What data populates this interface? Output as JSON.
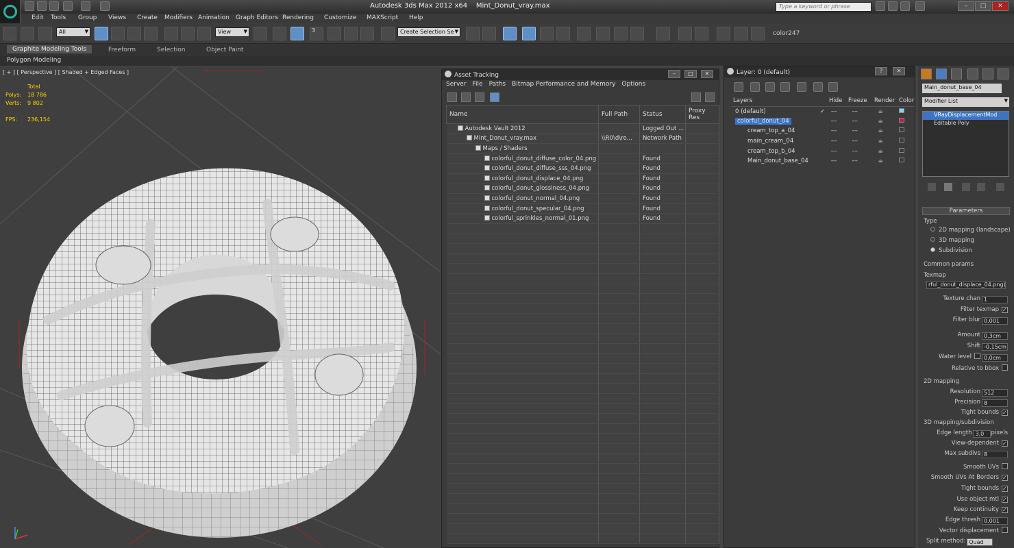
{
  "title": {
    "app": "Autodesk 3ds Max  2012 x64",
    "file": "Mint_Donut_vray.max",
    "search_placeholder": "Type a keyword or phrase"
  },
  "menu": [
    "Edit",
    "Tools",
    "Group",
    "Views",
    "Create",
    "Modifiers",
    "Animation",
    "Graph Editors",
    "Rendering",
    "Customize",
    "MAXScript",
    "Help"
  ],
  "toolbar": {
    "filter": "All",
    "refcoord": "View",
    "selset": "Create Selection Se",
    "color_label": "color247",
    "snap_label": "3"
  },
  "ribbon": {
    "tabs": [
      "Graphite Modeling Tools",
      "Freeform",
      "Selection",
      "Object Paint"
    ],
    "sub": "Polygon Modeling"
  },
  "viewport": {
    "label": "[ + ] [ Perspective ] [ Shaded + Edged Faces ]",
    "stats": {
      "total": "Total",
      "polys_label": "Polys:",
      "polys": "18 786",
      "verts_label": "Verts:",
      "verts": "9 802",
      "fps_label": "FPS:",
      "fps": "236,154"
    }
  },
  "asset": {
    "title": "Asset Tracking",
    "menu": [
      "Server",
      "File",
      "Paths",
      "Bitmap Performance and Memory",
      "Options"
    ],
    "columns": [
      "Name",
      "Full Path",
      "Status",
      "Proxy Res"
    ],
    "rows": [
      {
        "name": "Autodesk Vault 2012",
        "path": "",
        "status": "Logged Out ...",
        "indent": 0
      },
      {
        "name": "Mint_Donut_vray.max",
        "path": "\\\\R0\\d\\re...",
        "status": "Network Path",
        "indent": 1
      },
      {
        "name": "Maps / Shaders",
        "path": "",
        "status": "",
        "indent": 2
      },
      {
        "name": "colorful_donut_diffuse_color_04.png",
        "path": "",
        "status": "Found",
        "indent": 3
      },
      {
        "name": "colorful_donut_diffuse_sss_04.png",
        "path": "",
        "status": "Found",
        "indent": 3
      },
      {
        "name": "colorful_donut_displace_04.png",
        "path": "",
        "status": "Found",
        "indent": 3
      },
      {
        "name": "colorful_donut_glossiness_04.png",
        "path": "",
        "status": "Found",
        "indent": 3
      },
      {
        "name": "colorful_donut_normal_04.png",
        "path": "",
        "status": "Found",
        "indent": 3
      },
      {
        "name": "colorful_donut_specular_04.png",
        "path": "",
        "status": "Found",
        "indent": 3
      },
      {
        "name": "colorful_sprinkles_normal_01.png",
        "path": "",
        "status": "Found",
        "indent": 3
      }
    ]
  },
  "layers": {
    "title": "Layer: 0 (default)",
    "columns": [
      "Layers",
      "Hide",
      "Freeze",
      "Render",
      "Color"
    ],
    "rows": [
      {
        "name": "0 (default)",
        "indent": 0,
        "color": "#7fd4ff",
        "sel": false,
        "check": "✓"
      },
      {
        "name": "colorful_donut_04",
        "indent": 0,
        "color": "#c8184a",
        "sel": true,
        "check": ""
      },
      {
        "name": "cream_top_a_04",
        "indent": 1,
        "color": "",
        "sel": false,
        "check": ""
      },
      {
        "name": "main_cream_04",
        "indent": 1,
        "color": "",
        "sel": false,
        "check": ""
      },
      {
        "name": "cream_top_b_04",
        "indent": 1,
        "color": "",
        "sel": false,
        "check": ""
      },
      {
        "name": "Main_donut_base_04",
        "indent": 1,
        "color": "",
        "sel": false,
        "check": ""
      }
    ]
  },
  "cmd": {
    "object_name": "Main_donut_base_04",
    "modifier_list": "Modifier List",
    "stack": [
      "VRayDisplacementMod",
      "Editable Poly"
    ],
    "params": {
      "rollout": "Parameters",
      "type_label": "Type",
      "types": [
        "2D mapping (landscape)",
        "3D mapping",
        "Subdivision"
      ],
      "common": "Common params",
      "texmap_label": "Texmap",
      "texmap": "rful_donut_displace_04.png)",
      "texture_chan_label": "Texture chan",
      "texture_chan": "1",
      "filter_texmap_label": "Filter texmap",
      "filter_blur_label": "Filter blur",
      "filter_blur": "0,001",
      "amount_label": "Amount",
      "amount": "0,3cm",
      "shift_label": "Shift",
      "shift": "-0,15cm",
      "water_label": "Water level",
      "water": "0,0cm",
      "relbbox_label": "Relative to bbox",
      "map2d": "2D mapping",
      "resolution_label": "Resolution",
      "resolution": "512",
      "precision_label": "Precision",
      "precision": "8",
      "tight_label": "Tight bounds",
      "map3d": "3D mapping/subdivision",
      "edge_label": "Edge length",
      "edge": "3,0",
      "pixels": "pixels",
      "viewdep_label": "View-dependent",
      "maxsub_label": "Max subdivs",
      "maxsub": "8",
      "smoothuv_label": "Smooth UVs",
      "smoothborder_label": "Smooth UVs At Borders",
      "tight2_label": "Tight bounds",
      "useobj_label": "Use object mtl",
      "keepcont_label": "Keep continuity",
      "edgethresh_label": "Edge thresh",
      "edgethresh": "0,001",
      "vecdisp_label": "Vector displacement",
      "split_label": "Split method:",
      "split": "Quad"
    }
  }
}
